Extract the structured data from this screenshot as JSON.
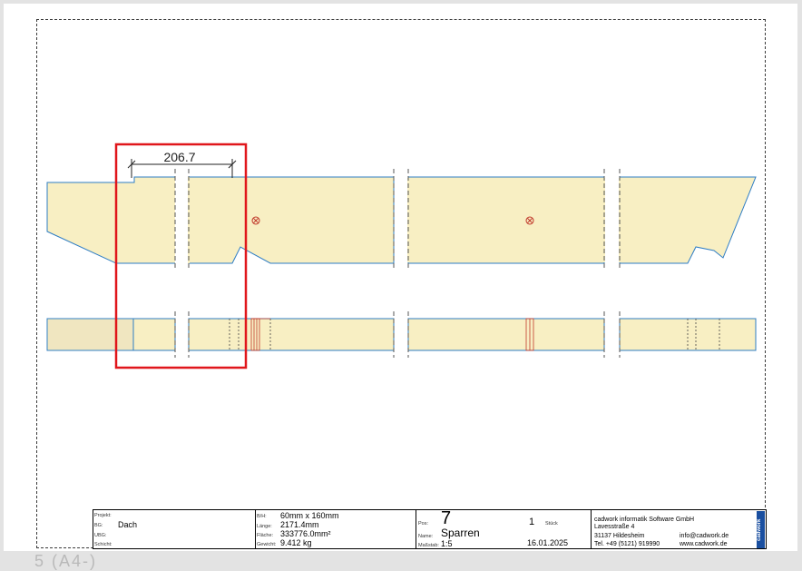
{
  "dimension": {
    "value": "206.7"
  },
  "page": {
    "label": "5 (A4-)"
  },
  "title_block": {
    "projekt_label": "Projekt:",
    "projekt_value": "",
    "bg_label": "BG:",
    "bg_value": "Dach",
    "ubg_label": "UBG:",
    "schicht_label": "Schicht:",
    "bh_label": "B/H:",
    "bh_value": "60mm x 160mm",
    "laenge_label": "Länge:",
    "laenge_value": "2171.4mm",
    "flaeche_label": "Fläche:",
    "flaeche_value": "333776.0mm²",
    "gewicht_label": "Gewicht:",
    "gewicht_value": "9.412 kg",
    "pos_label": "Pos:",
    "pos_value": "7",
    "name_label": "Name:",
    "name_value": "Sparren",
    "massstab_label": "Maßstab:",
    "massstab_value": "1:5",
    "stueck_value": "1",
    "stueck_label": "Stück",
    "date_value": "16.01.2025",
    "company_name": "cadwork informatik Software GmbH",
    "company_street": "Lavesstraße 4",
    "company_city": "31137 Hildesheim",
    "company_phone": "Tel. +49 (5121) 919990",
    "company_email": "info@cadwork.de",
    "company_web": "www.cadwork.de",
    "logo_text": "cadwork"
  },
  "colors": {
    "fill": "#f8efc3",
    "outline": "#2e7dc4",
    "highlight": "#e0161b",
    "hatch": "#c0392b"
  }
}
